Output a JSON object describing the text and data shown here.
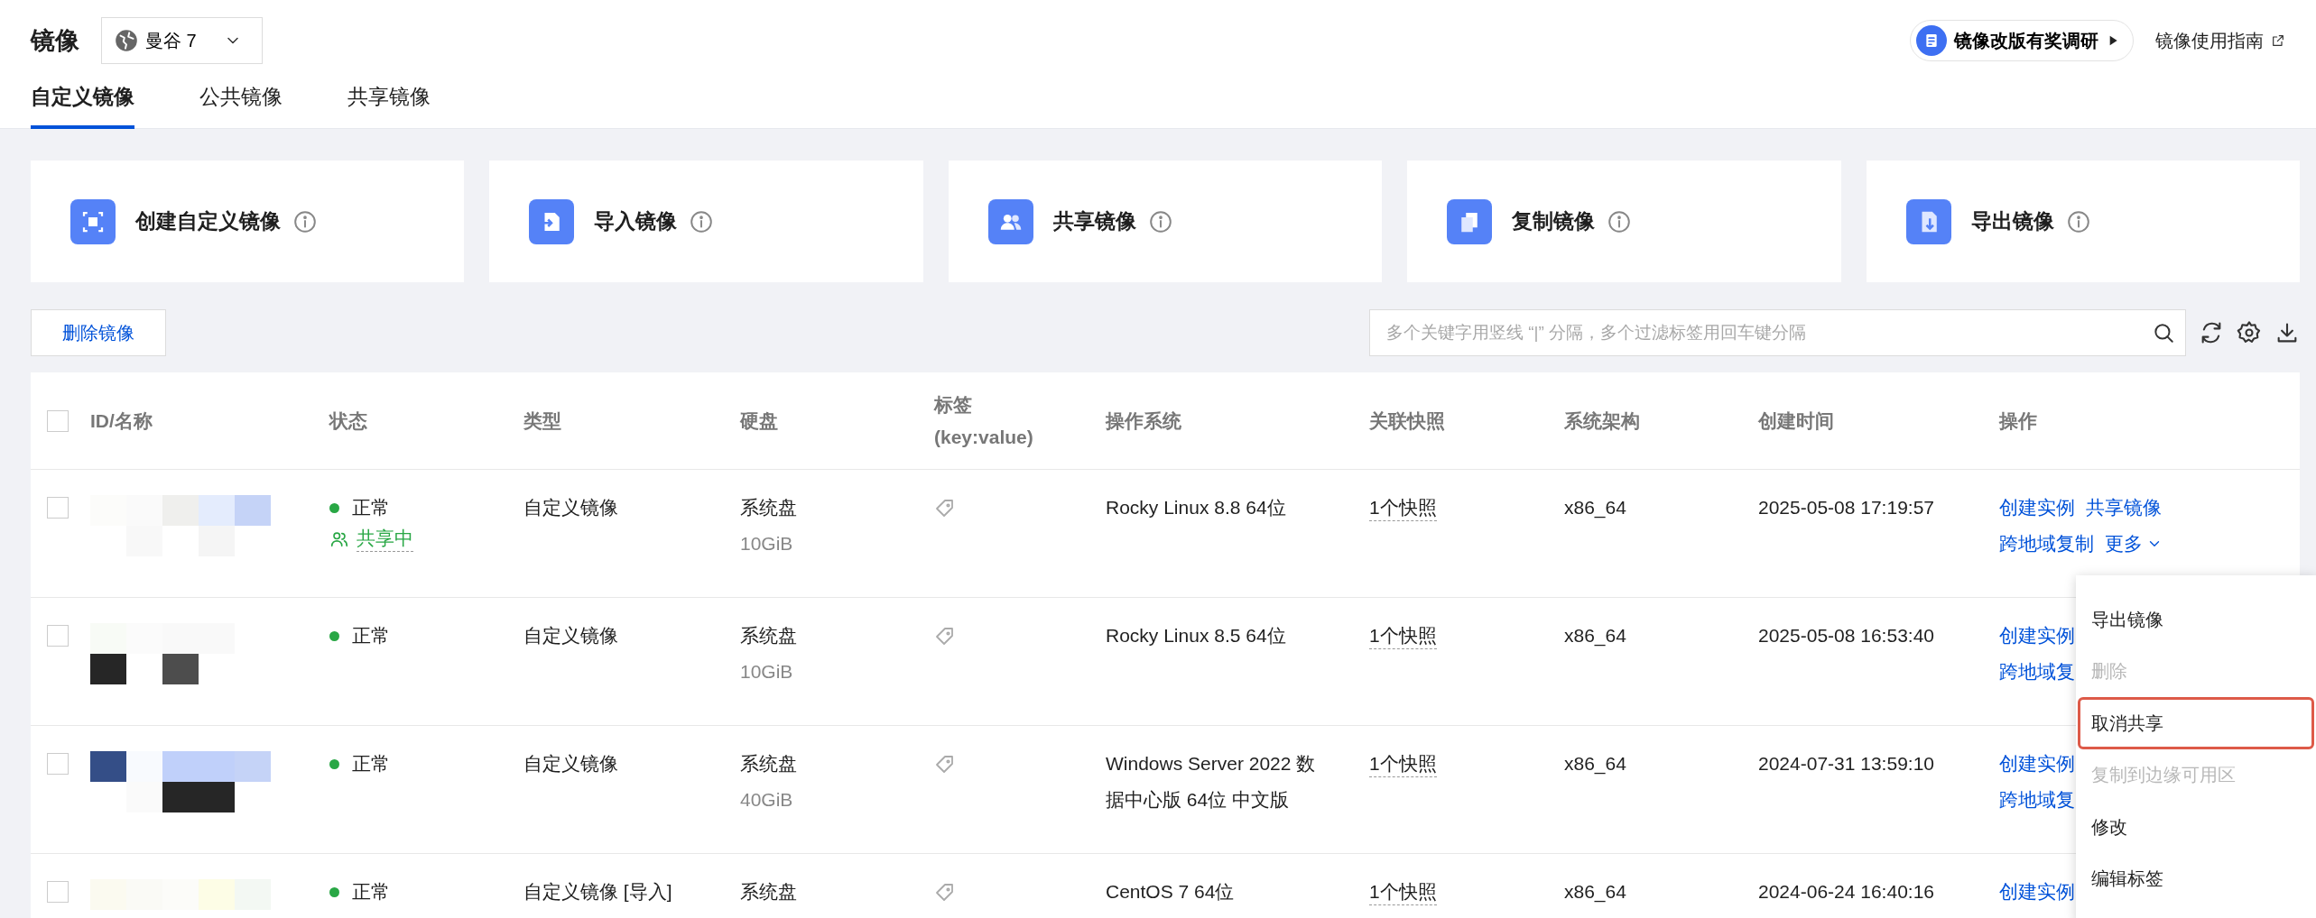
{
  "header": {
    "title": "镜像",
    "region": "曼谷 7",
    "survey": "镜像改版有奖调研",
    "guide": "镜像使用指南"
  },
  "tabs": [
    {
      "label": "自定义镜像",
      "selected": true
    },
    {
      "label": "公共镜像",
      "selected": false
    },
    {
      "label": "共享镜像",
      "selected": false
    }
  ],
  "action_cards": [
    {
      "label": "创建自定义镜像"
    },
    {
      "label": "导入镜像"
    },
    {
      "label": "共享镜像"
    },
    {
      "label": "复制镜像"
    },
    {
      "label": "导出镜像"
    }
  ],
  "toolbar": {
    "delete_button": "删除镜像",
    "search": {
      "placeholder": "多个关键字用竖线 “|” 分隔，多个过滤标签用回车键分隔"
    }
  },
  "table": {
    "columns": [
      {
        "label": "ID/名称"
      },
      {
        "label": "状态"
      },
      {
        "label": "类型"
      },
      {
        "label": "硬盘"
      },
      {
        "label": "标签",
        "sublabel": "(key:value)"
      },
      {
        "label": "操作系统"
      },
      {
        "label": "关联快照"
      },
      {
        "label": "系统架构"
      },
      {
        "label": "创建时间"
      },
      {
        "label": "操作"
      }
    ],
    "select_all_checked": false,
    "rows": [
      {
        "checked": false,
        "status": "正常",
        "sharing": "共享中",
        "type": "自定义镜像",
        "disk": "系统盘",
        "size": "10GiB",
        "os": "Rocky Linux 8.8 64位",
        "snapshot": "1个快照",
        "arch": "x86_64",
        "created": "2025-05-08 17:19:57",
        "action_lines": [
          [
            {
              "label": "创建实例",
              "kind": "link"
            },
            {
              "label": "共享镜像",
              "kind": "link"
            }
          ],
          [
            {
              "label": "跨地域复制",
              "kind": "link"
            },
            {
              "label": "更多",
              "kind": "dropdown"
            }
          ]
        ]
      },
      {
        "checked": false,
        "status": "正常",
        "type": "自定义镜像",
        "disk": "系统盘",
        "size": "10GiB",
        "os": "Rocky Linux 8.5 64位",
        "snapshot": "1个快照",
        "arch": "x86_64",
        "created": "2025-05-08 16:53:40",
        "action_lines": [
          [
            {
              "label": "创建实例",
              "kind": "link"
            }
          ],
          [
            {
              "label": "跨地域复",
              "kind": "link"
            }
          ]
        ]
      },
      {
        "checked": false,
        "status": "正常",
        "type": "自定义镜像",
        "disk": "系统盘",
        "size": "40GiB",
        "os": "Windows Server 2022 数据中心版 64位 中文版",
        "snapshot": "1个快照",
        "arch": "x86_64",
        "created": "2024-07-31 13:59:10",
        "action_lines": [
          [
            {
              "label": "创建实例",
              "kind": "link"
            }
          ],
          [
            {
              "label": "跨地域复",
              "kind": "link"
            }
          ]
        ]
      },
      {
        "checked": false,
        "status": "正常",
        "type": "自定义镜像 [导入]",
        "disk": "系统盘",
        "os": "CentOS 7 64位",
        "snapshot": "1个快照",
        "arch": "x86_64",
        "created": "2024-06-24 16:40:16",
        "action_lines": [
          [
            {
              "label": "创建实例",
              "kind": "link"
            }
          ]
        ]
      }
    ]
  },
  "more_menu": [
    {
      "label": "导出镜像",
      "disabled": false,
      "highlighted": false
    },
    {
      "label": "删除",
      "disabled": true,
      "highlighted": false
    },
    {
      "label": "取消共享",
      "disabled": false,
      "highlighted": true
    },
    {
      "label": "复制到边缘可用区",
      "disabled": true,
      "highlighted": false
    },
    {
      "label": "修改",
      "disabled": false,
      "highlighted": false
    },
    {
      "label": "编辑标签",
      "disabled": false,
      "highlighted": false
    }
  ]
}
